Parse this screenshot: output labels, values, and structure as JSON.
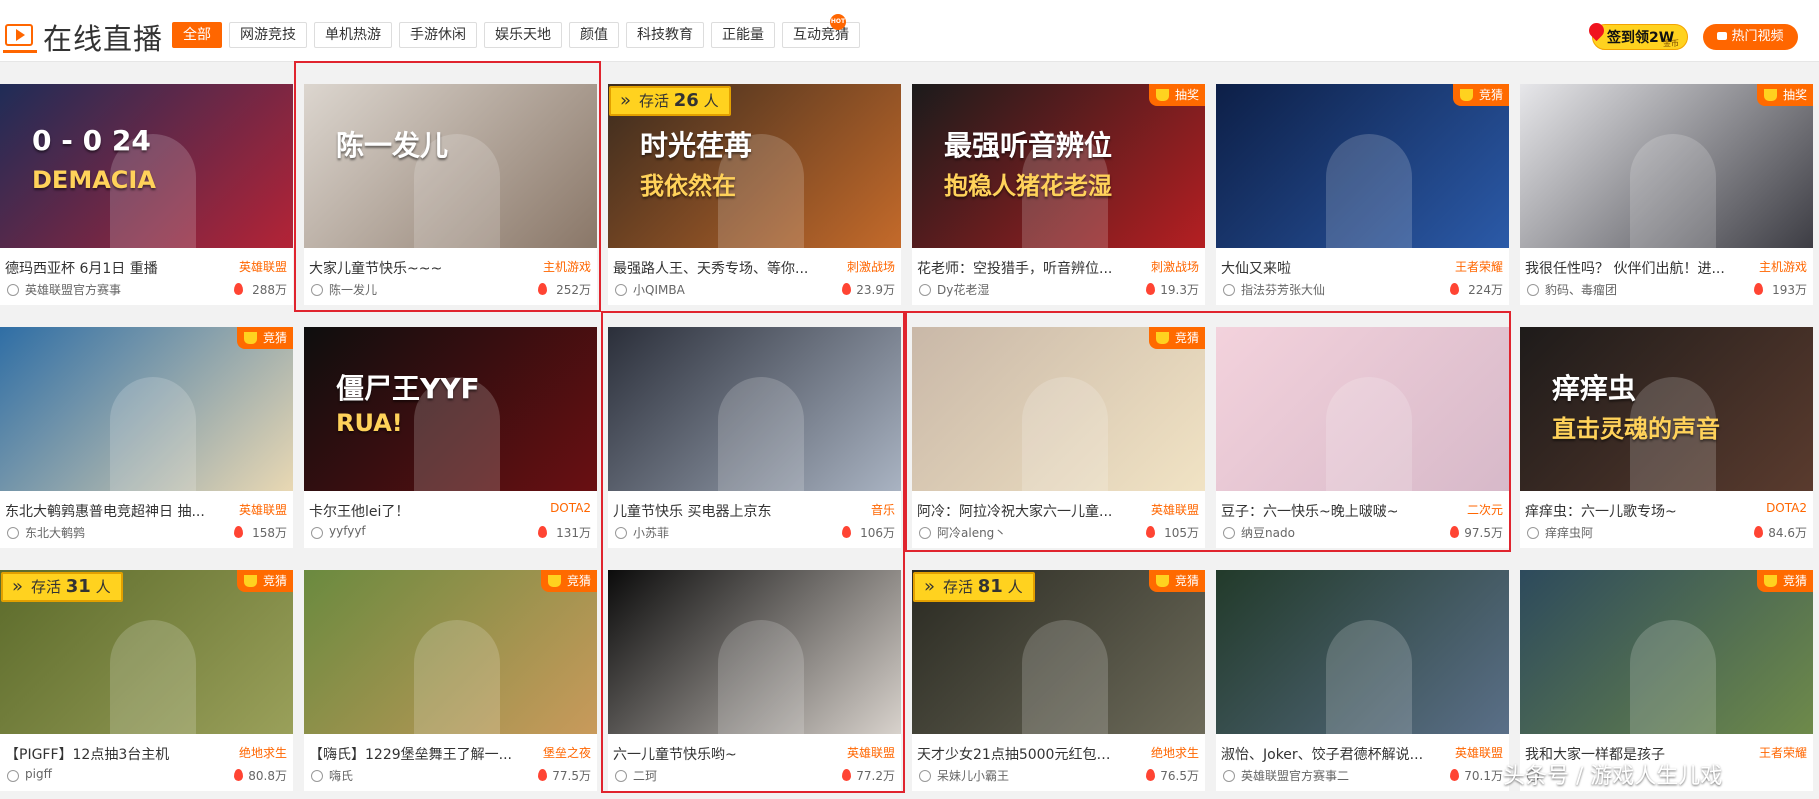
{
  "header": {
    "title": "在线直播",
    "tabs": [
      {
        "label": "全部",
        "active": true
      },
      {
        "label": "网游竞技"
      },
      {
        "label": "单机热游"
      },
      {
        "label": "手游休闲"
      },
      {
        "label": "娱乐天地"
      },
      {
        "label": "颜值"
      },
      {
        "label": "科技教育"
      },
      {
        "label": "正能量"
      },
      {
        "label": "互动竞猜",
        "badge": "HOT"
      }
    ],
    "signin": {
      "label": "签到领2W",
      "sub": "金币"
    },
    "hot_video": "热门视频"
  },
  "colors": {
    "accent": "#ff6600",
    "highlight": "#e0242e",
    "tag": "#ff6a00",
    "alive": "#ffd21f"
  },
  "cards": [
    {
      "title": "德玛西亚杯 6月1日 重播",
      "category": "英雄联盟",
      "owner": "英雄联盟官方赛事",
      "views": "288万",
      "tag": "",
      "alive": "",
      "thumb": [
        "#1f2c57",
        "#b42336"
      ],
      "overlay": "0 - 0   24",
      "overlay2": "DEMACIA"
    },
    {
      "title": "大家儿童节快乐~~~",
      "category": "主机游戏",
      "owner": "陈一发儿",
      "views": "252万",
      "tag": "",
      "alive": "",
      "thumb": [
        "#dcd6cf",
        "#8a7768"
      ],
      "overlay": "陈一发儿",
      "overlay2": ""
    },
    {
      "title": "最强路人王、天秀专场、等你...",
      "category": "刺激战场",
      "owner": "小QIMBA",
      "views": "23.9万",
      "tag": "",
      "alive": "26",
      "thumb": [
        "#3b2b1e",
        "#c46a2a"
      ],
      "overlay": "时光荏苒",
      "overlay2": "我依然在"
    },
    {
      "title": "花老师：空投猎手，听音辨位...",
      "category": "刺激战场",
      "owner": "Dy花老湿",
      "views": "19.3万",
      "tag": "抽奖",
      "alive": "",
      "thumb": [
        "#1b1b1b",
        "#b51f22"
      ],
      "overlay": "最强听音辨位",
      "overlay2": "抱稳人猪花老湿"
    },
    {
      "title": "大仙又来啦",
      "category": "王者荣耀",
      "owner": "指法芬芳张大仙",
      "views": "224万",
      "tag": "竞猜",
      "alive": "",
      "thumb": [
        "#0d1f47",
        "#2b5aa8"
      ],
      "overlay": "",
      "overlay2": ""
    },
    {
      "title": "我很任性吗？ 伙伴们出航！进...",
      "category": "主机游戏",
      "owner": "豹码、毒瘤团",
      "views": "193万",
      "tag": "抽奖",
      "alive": "",
      "thumb": [
        "#e7e7ea",
        "#3d3d44"
      ],
      "overlay": "",
      "overlay2": ""
    },
    {
      "title": "东北大鹌鹑惠普电竞超神日 抽...",
      "category": "英雄联盟",
      "owner": "东北大鹌鹑",
      "views": "158万",
      "tag": "竞猜",
      "alive": "",
      "thumb": [
        "#2f6ea5",
        "#e9d8b3"
      ],
      "overlay": "",
      "overlay2": ""
    },
    {
      "title": "卡尔王他lei了！",
      "category": "DOTA2",
      "owner": "yyfyyf",
      "views": "131万",
      "tag": "",
      "alive": "",
      "thumb": [
        "#0e0e0e",
        "#6a0f12"
      ],
      "overlay": "僵尸王YYF",
      "overlay2": "RUA!"
    },
    {
      "title": "儿童节快乐 买电器上京东",
      "category": "音乐",
      "owner": "小苏菲",
      "views": "106万",
      "tag": "",
      "alive": "",
      "thumb": [
        "#2b2f3a",
        "#a9b3c2"
      ],
      "overlay": "",
      "overlay2": ""
    },
    {
      "title": "阿冷：阿拉冷祝大家六一儿童...",
      "category": "英雄联盟",
      "owner": "阿冷aleng丶",
      "views": "105万",
      "tag": "竞猜",
      "alive": "",
      "thumb": [
        "#c9b8a8",
        "#f1e3c4"
      ],
      "overlay": "",
      "overlay2": ""
    },
    {
      "title": "豆子：六一快乐~晚上啵啵~",
      "category": "二次元",
      "owner": "纳豆nado",
      "views": "97.5万",
      "tag": "",
      "alive": "",
      "thumb": [
        "#f3d2dc",
        "#d7b9c9"
      ],
      "overlay": "",
      "overlay2": ""
    },
    {
      "title": "痒痒虫：六一儿歌专场~",
      "category": "DOTA2",
      "owner": "痒痒虫阿",
      "views": "84.6万",
      "tag": "",
      "alive": "",
      "thumb": [
        "#1e1b1a",
        "#5a3b2e"
      ],
      "overlay": "痒痒虫",
      "overlay2": "直击灵魂的声音"
    },
    {
      "title": "【PIGFF】12点抽3台主机",
      "category": "绝地求生",
      "owner": "pigff",
      "views": "80.8万",
      "tag": "竞猜",
      "alive": "31",
      "thumb": [
        "#5c6b2b",
        "#9aa05a"
      ],
      "overlay": "",
      "overlay2": ""
    },
    {
      "title": "【嗨氏】1229堡垒舞王了解一...",
      "category": "堡垒之夜",
      "owner": "嗨氏",
      "views": "77.5万",
      "tag": "竞猜",
      "alive": "",
      "thumb": [
        "#6a8a3f",
        "#c99a5b"
      ],
      "overlay": "",
      "overlay2": ""
    },
    {
      "title": "六一儿童节快乐哟~",
      "category": "英雄联盟",
      "owner": "二珂",
      "views": "77.2万",
      "tag": "",
      "alive": "",
      "thumb": [
        "#0b0b0b",
        "#d8d2cc"
      ],
      "overlay": "",
      "overlay2": ""
    },
    {
      "title": "天才少女21点抽5000元红包现...",
      "category": "绝地求生",
      "owner": "呆妹儿小霸王",
      "views": "76.5万",
      "tag": "竞猜",
      "alive": "81",
      "thumb": [
        "#2a2a22",
        "#6d6b5a"
      ],
      "overlay": "",
      "overlay2": ""
    },
    {
      "title": "淑怡、Joker、饺子君德杯解说...",
      "category": "英雄联盟",
      "owner": "英雄联盟官方赛事二",
      "views": "70.1万",
      "tag": "",
      "alive": "",
      "thumb": [
        "#223a2a",
        "#5a6f88"
      ],
      "overlay": "",
      "overlay2": ""
    },
    {
      "title": "我和大家一样都是孩子",
      "category": "王者荣耀",
      "owner": "",
      "views": "",
      "tag": "竞猜",
      "alive": "",
      "thumb": [
        "#2d4a5c",
        "#6e8a4a"
      ],
      "overlay": "",
      "overlay2": ""
    }
  ],
  "watermark": "头条号 / 游戏人生儿戏"
}
